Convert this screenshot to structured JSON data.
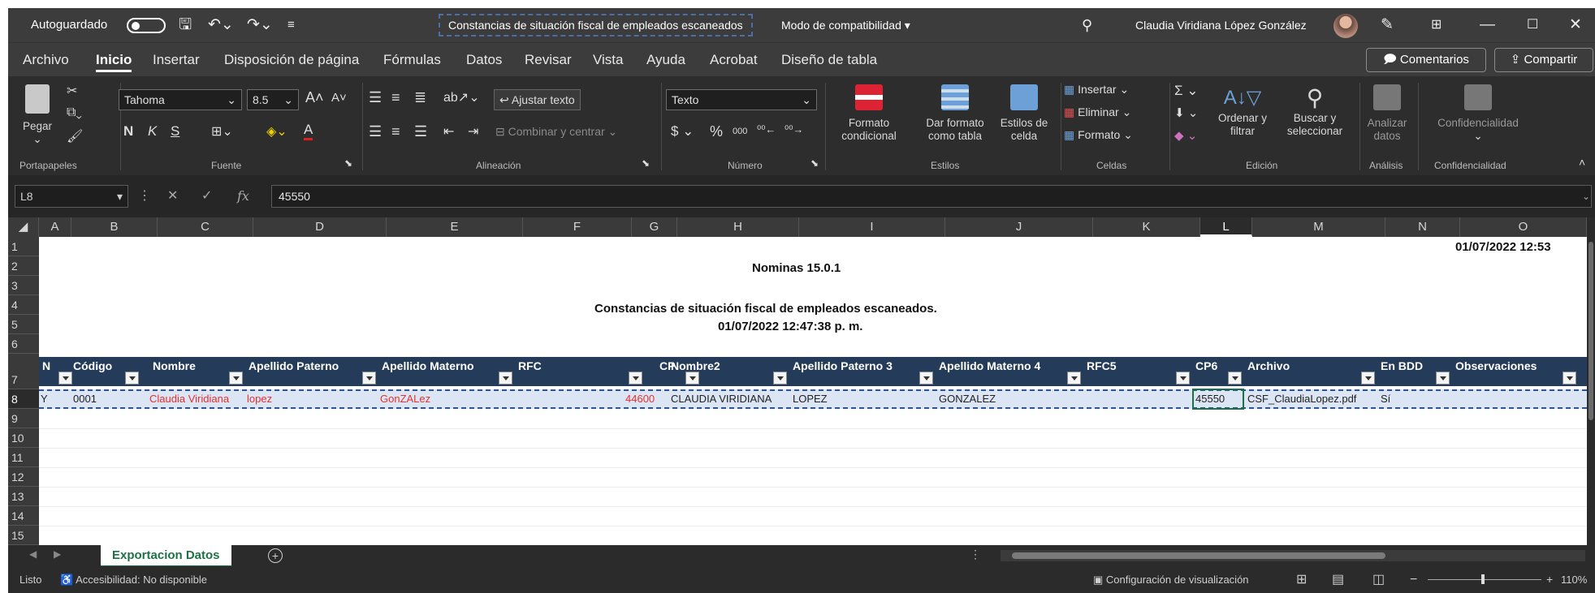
{
  "titlebar": {
    "autosave_label": "Autoguardado",
    "doc_title": "Constancias de situación fiscal de empleados escaneados",
    "compat_label": "Modo de compatibilidad",
    "user_name": "Claudia Viridiana López González"
  },
  "menu": {
    "items": [
      "Archivo",
      "Inicio",
      "Insertar",
      "Disposición de página",
      "Fórmulas",
      "Datos",
      "Revisar",
      "Vista",
      "Ayuda",
      "Acrobat",
      "Diseño de tabla"
    ],
    "active": "Inicio",
    "comments_label": "Comentarios",
    "share_label": "Compartir"
  },
  "ribbon": {
    "clipboard": {
      "paste": "Pegar",
      "label": "Portapapeles"
    },
    "font": {
      "name": "Tahoma",
      "size": "8.5",
      "bold": "N",
      "italic": "K",
      "underline": "S",
      "label": "Fuente"
    },
    "alignment": {
      "wrap": "Ajustar texto",
      "merge": "Combinar y centrar",
      "label": "Alineación"
    },
    "number": {
      "format": "Texto",
      "label": "Número"
    },
    "styles": {
      "cond_format": "Formato condicional",
      "as_table": "Dar formato como tabla",
      "cell_styles": "Estilos de celda",
      "label": "Estilos"
    },
    "cells": {
      "insert": "Insertar",
      "delete": "Eliminar",
      "format": "Formato",
      "label": "Celdas"
    },
    "editing": {
      "sort": "Ordenar y filtrar",
      "find": "Buscar y seleccionar",
      "label": "Edición"
    },
    "analysis": {
      "analyze": "Analizar datos",
      "label": "Análisis"
    },
    "sensitivity": {
      "button": "Confidencialidad",
      "label": "Confidencialidad"
    }
  },
  "formula_bar": {
    "name_box": "L8",
    "value": "45550"
  },
  "columns": [
    "A",
    "B",
    "C",
    "D",
    "E",
    "F",
    "G",
    "H",
    "I",
    "J",
    "K",
    "L",
    "M",
    "N",
    "O"
  ],
  "active_column": "L",
  "rows": [
    "1",
    "2",
    "3",
    "4",
    "5",
    "6",
    "7",
    "8",
    "9",
    "10",
    "11",
    "12",
    "13",
    "14",
    "15"
  ],
  "active_row": "8",
  "report": {
    "timestamp": "01/07/2022 12:53",
    "title": "Nominas 15.0.1",
    "subtitle": "Constancias de situación fiscal de empleados escaneados.",
    "generated": "01/07/2022 12:47:38 p. m."
  },
  "table": {
    "headers": [
      "N",
      "Código",
      "Nombre",
      "Apellido Paterno",
      "Apellido Materno",
      "RFC",
      "CP",
      "Nombre2",
      "Apellido Paterno 3",
      "Apellido Materno 4",
      "RFC5",
      "CP6",
      "Archivo",
      "En BDD",
      "Observaciones"
    ],
    "row": [
      "Y",
      "0001",
      "Claudia Viridiana",
      "lopez",
      "GonZALez",
      "",
      "44600",
      "CLAUDIA VIRIDIANA",
      "LOPEZ",
      "GONZALEZ",
      "",
      "45550",
      "CSF_ClaudiaLopez.pdf",
      "Sí",
      ""
    ],
    "red_text_color": "#e53030",
    "header_color": "#243b5a"
  },
  "sheet_tab": "Exportacion Datos",
  "status": {
    "ready": "Listo",
    "accessibility": "Accesibilidad: No disponible",
    "display_settings": "Configuración de visualización",
    "zoom": "110%"
  }
}
